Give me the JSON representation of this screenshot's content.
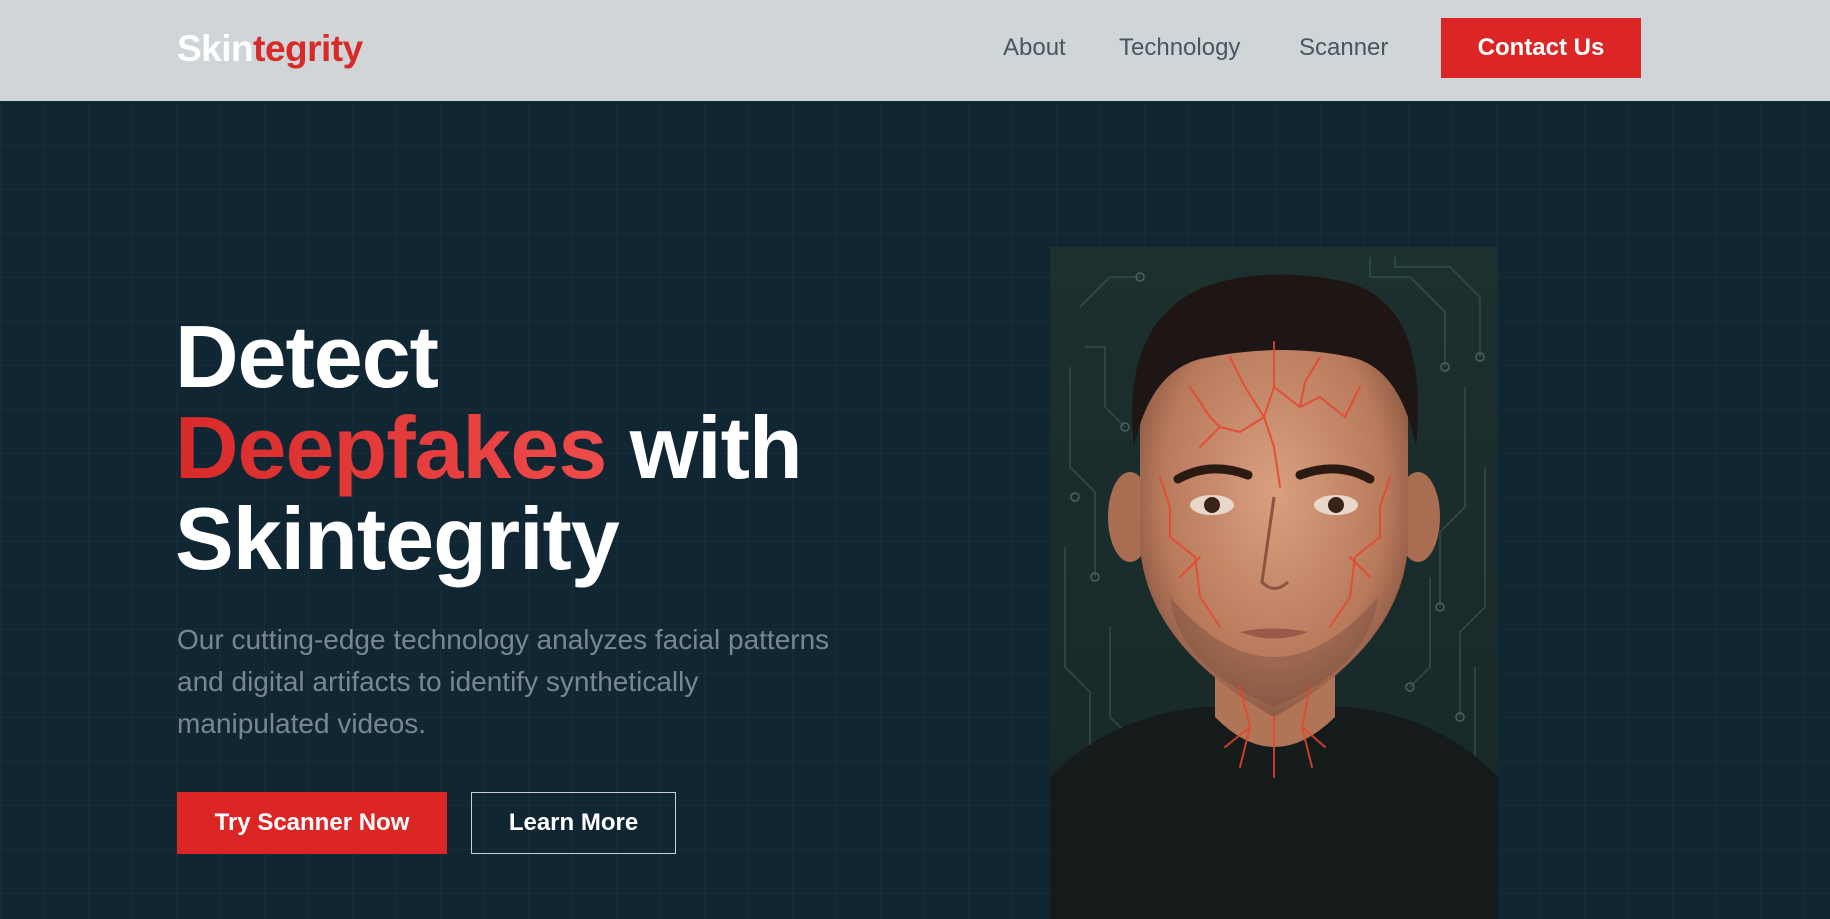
{
  "header": {
    "brand_part1": "Skin",
    "brand_part2": "tegrity",
    "nav": [
      "About",
      "Technology",
      "Scanner"
    ],
    "contact_label": "Contact Us"
  },
  "hero": {
    "headline_line1": "Detect",
    "headline_accent": "Deepfakes",
    "headline_line2_rest": " with",
    "headline_line3": "Skintegrity",
    "subtitle": "Our cutting-edge technology analyzes facial patterns and digital artifacts to identify synthetically manipulated videos.",
    "primary_cta": "Try Scanner Now",
    "secondary_cta": "Learn More"
  },
  "colors": {
    "accent": "#dc2626",
    "hero_bg": "#112633",
    "header_bg": "#d0d5d8",
    "subtitle": "#7a8791"
  },
  "portrait": {
    "subject": "man-face-with-red-vein-pattern"
  }
}
